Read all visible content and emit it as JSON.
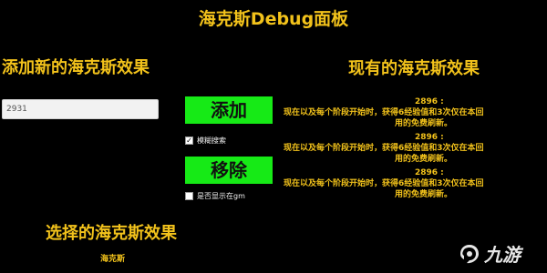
{
  "panel": {
    "title": "海克斯Debug面板"
  },
  "add_section": {
    "title": "添加新的海克斯效果",
    "input_value": "2931",
    "add_button_label": "添加",
    "fuzzy_search_label": "模糊搜索",
    "fuzzy_search_checked": true,
    "remove_button_label": "移除",
    "show_in_gm_label": "是否显示在gm",
    "show_in_gm_checked": false
  },
  "existing_section": {
    "title": "现有的海克斯效果",
    "effects": [
      {
        "id": "2896 :",
        "line1": "现在以及每个阶段开始时，获得6经验值和3次仅在本回",
        "line2": "用的免费刷新。"
      },
      {
        "id": "2896 :",
        "line1": "现在以及每个阶段开始时，获得6经验值和3次仅在本回",
        "line2": "用的免费刷新。"
      },
      {
        "id": "2896 :",
        "line1": "现在以及每个阶段开始时，获得6经验值和3次仅在本回",
        "line2": "用的免费刷新。"
      }
    ]
  },
  "select_section": {
    "title": "选择的海克斯效果",
    "selected": "海克斯"
  },
  "watermark": {
    "text": "九游",
    "icon": "jiuyou-logo-icon"
  },
  "colors": {
    "background": "#000000",
    "text_accent": "#f2c21b",
    "button_green": "#16ea16"
  }
}
